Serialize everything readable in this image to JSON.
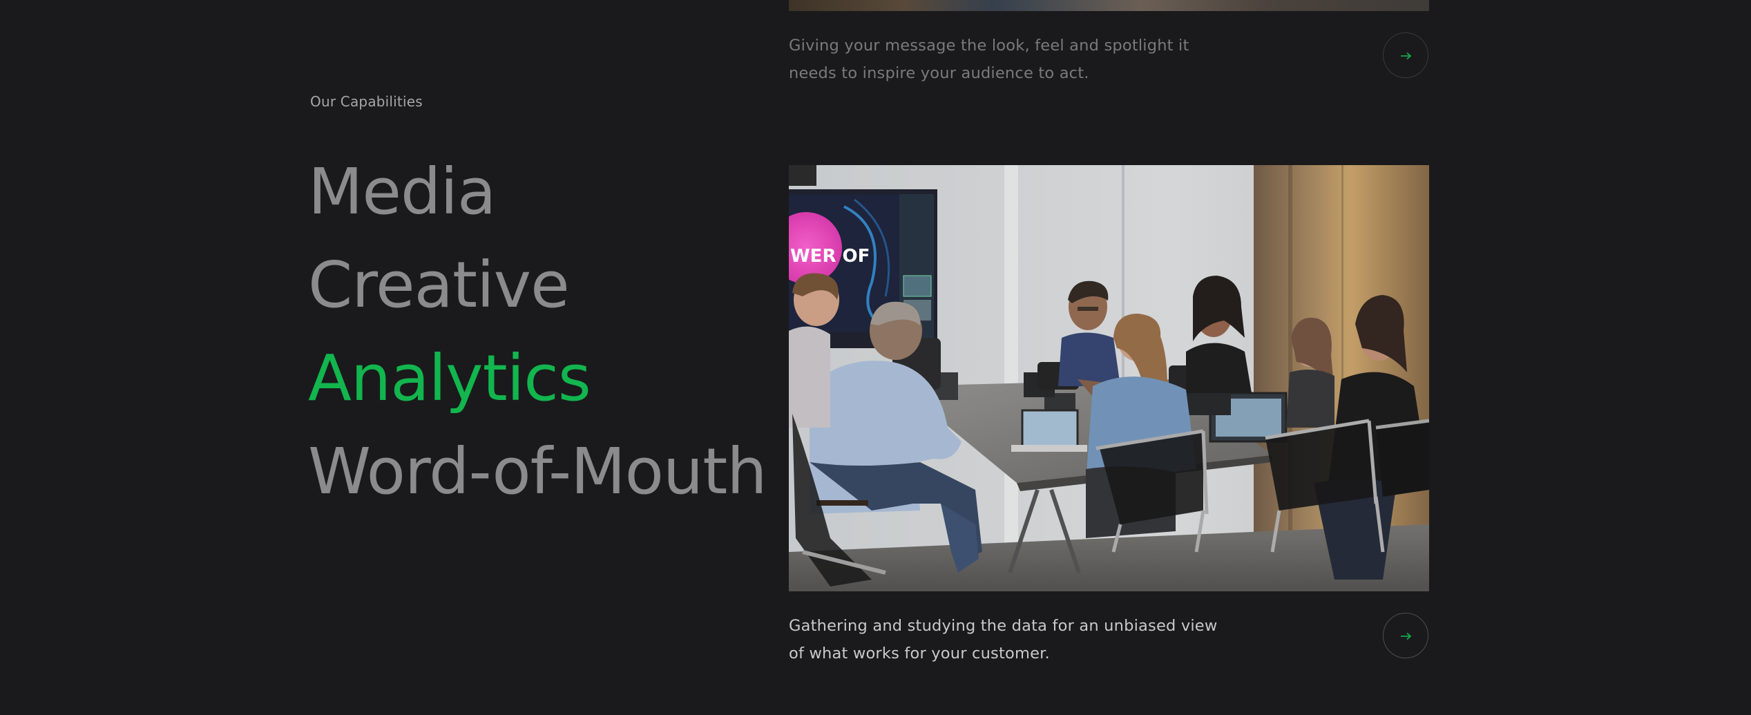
{
  "previous_card": {
    "description": "Giving your message the look, feel and spotlight it needs to inspire your audience to act.",
    "arrow_icon": "arrow-right-icon"
  },
  "capabilities": {
    "label": "Our Capabilities",
    "items": [
      {
        "label": "Media",
        "active": false
      },
      {
        "label": "Creative",
        "active": false
      },
      {
        "label": "Analytics",
        "active": true
      },
      {
        "label": "Word-of-Mouth",
        "active": false
      }
    ]
  },
  "active_card": {
    "image": "team-meeting-photo",
    "screen_text": "WER OF",
    "description": "Gathering and studying the data for an unbiased view of what works for your customer.",
    "arrow_icon": "arrow-right-icon"
  },
  "colors": {
    "background": "#1a1a1c",
    "accent": "#12b54e",
    "muted_text": "#8b8b8d"
  }
}
